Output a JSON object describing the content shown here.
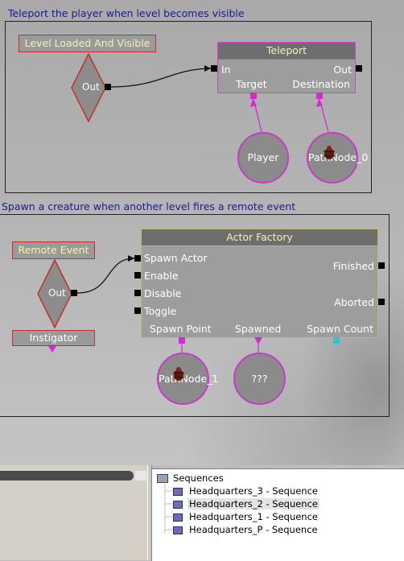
{
  "section1": {
    "comment": "Teleport the player when level becomes visible",
    "event_label": "Level Loaded And Visible",
    "event_out": "Out",
    "node": {
      "title": "Teleport",
      "in": "In",
      "out": "Out",
      "target": "Target",
      "destination": "Destination"
    },
    "var_player": "Player",
    "var_path": "PathNode_0"
  },
  "section2": {
    "comment": "Spawn a creature when another level fires a remote event",
    "event_label": "Remote Event",
    "event_out": "Out",
    "instigator": "Instigator",
    "node": {
      "title": "Actor Factory",
      "inputs": [
        "Spawn Actor",
        "Enable",
        "Disable",
        "Toggle"
      ],
      "finished": "Finished",
      "aborted": "Aborted",
      "spawn_point": "Spawn Point",
      "spawned": "Spawned",
      "spawn_count": "Spawn Count"
    },
    "var_path": "PathNode_1",
    "var_unknown": "???"
  },
  "tree": {
    "root": "Sequences",
    "items": [
      "Headquarters_3 - Sequence",
      "Headquarters_2 - Sequence",
      "Headquarters_1 - Sequence",
      "Headquarters_P - Sequence"
    ],
    "selected_index": 1
  },
  "colors": {
    "comment_text": "#1c1c8a",
    "event_border": "#c52f2f",
    "event_text": "#f4f4a8",
    "node_border": "#d442d4",
    "link_magenta": "#d62ad0",
    "link_cyan": "#27c9c9"
  },
  "icons": [
    "bug-icon",
    "folder-icon",
    "sequence-icon"
  ]
}
